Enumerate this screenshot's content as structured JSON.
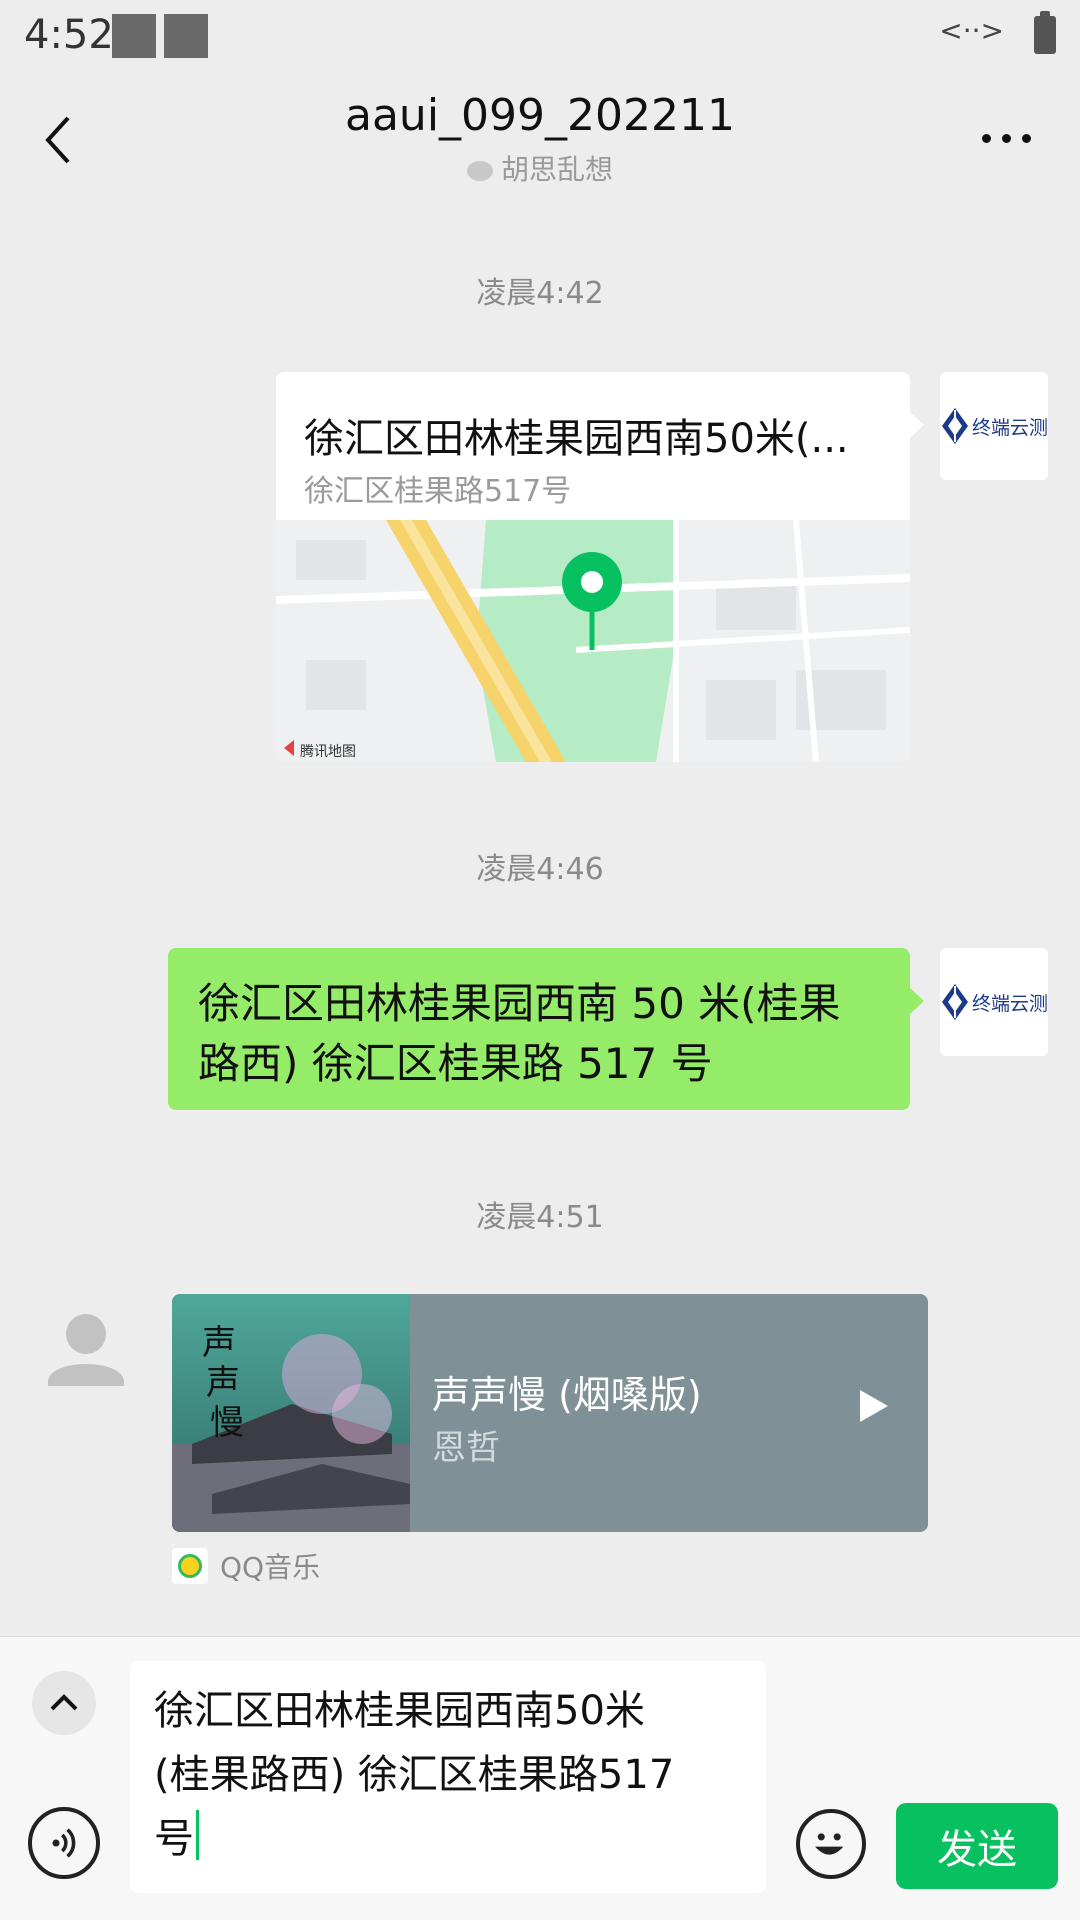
{
  "status_bar": {
    "time": "4:52"
  },
  "header": {
    "title": "aaui_099_202211",
    "subtitle": "胡思乱想"
  },
  "messages": {
    "ts1": "凌晨4:42",
    "location": {
      "title": "徐汇区田林桂果园西南50米(...",
      "address": "徐汇区桂果路517号",
      "map_provider": "腾讯地图"
    },
    "ts2": "凌晨4:46",
    "text_line1": "徐汇区田林桂果园西南 50 米(桂果",
    "text_line2": "路西) 徐汇区桂果路 517 号",
    "ts3": "凌晨4:51",
    "music": {
      "title": "声声慢 (烟嗓版)",
      "artist": "恩哲",
      "source": "QQ音乐"
    }
  },
  "avatar_me": {
    "text": "终端云测"
  },
  "input": {
    "line1": "徐汇区田林桂果园西南50米",
    "line2": "(桂果路西) 徐汇区桂果路517",
    "line3": "号",
    "send_label": "发送"
  },
  "colors": {
    "accent": "#07c160",
    "bubble_green": "#95ec69",
    "background": "#ededed"
  }
}
